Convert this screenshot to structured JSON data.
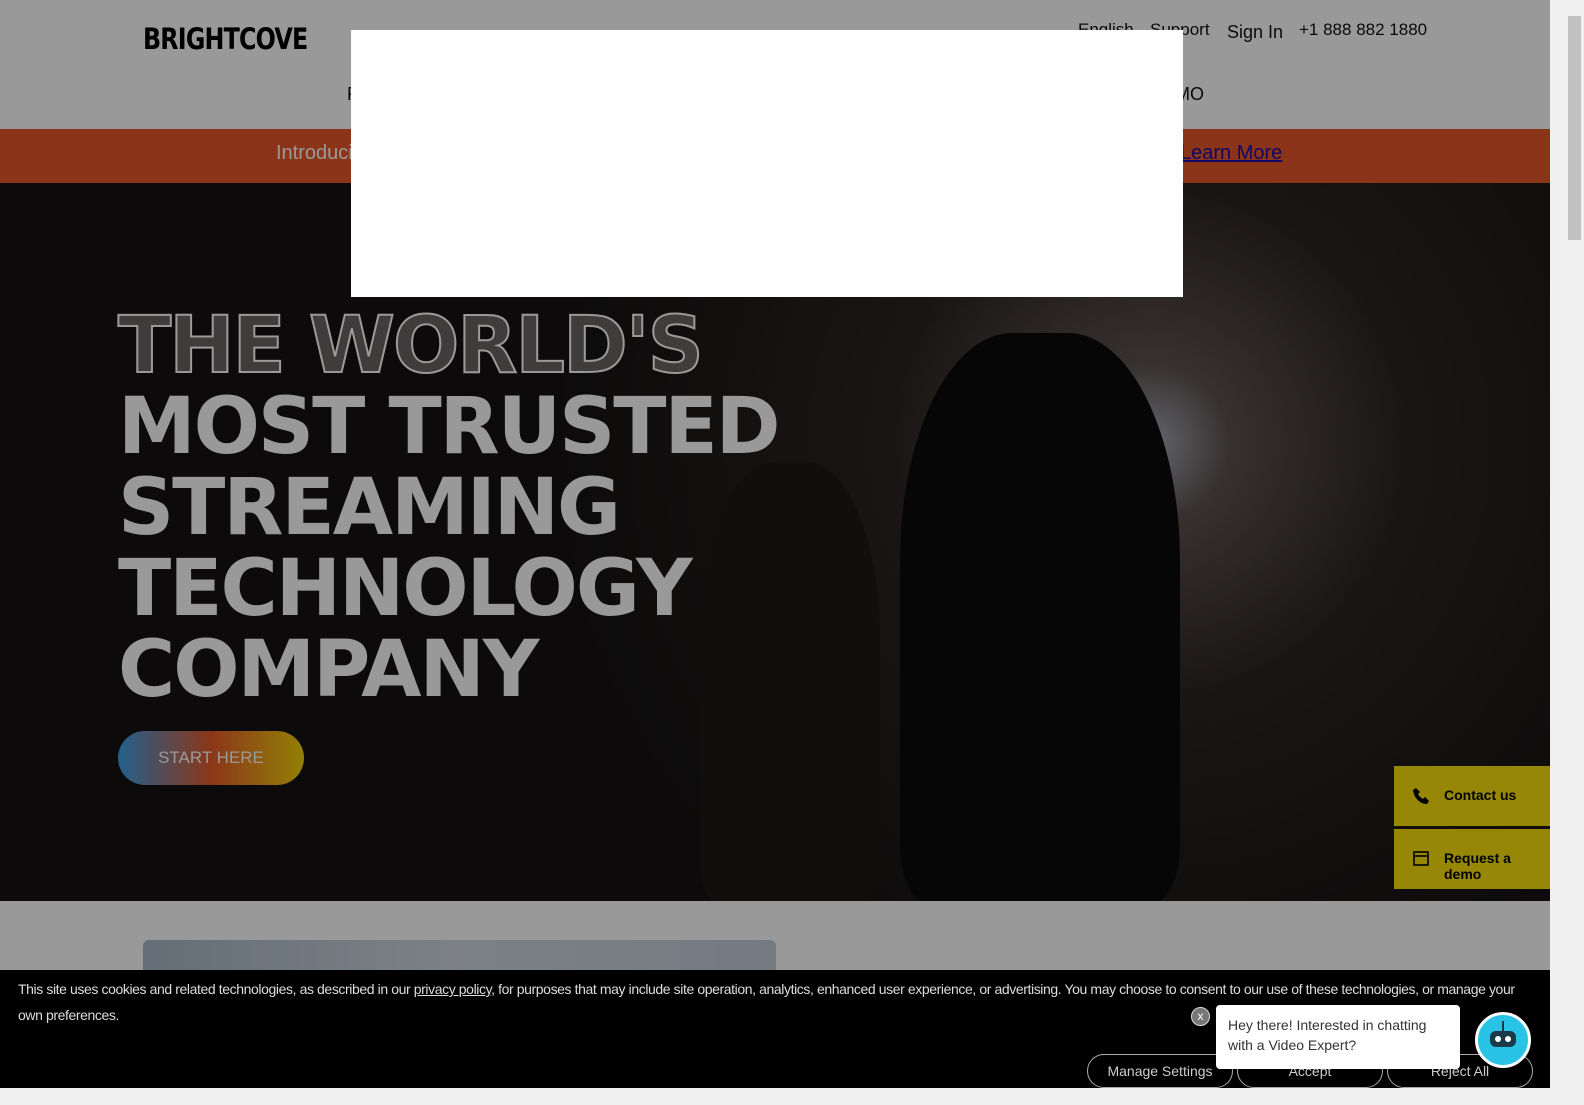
{
  "header": {
    "logo": "BRIGHTCOVE",
    "utility": [
      "English",
      "Support",
      "Sign In",
      "+1 888 882 1880"
    ],
    "nav_left_fragment": "P",
    "nav_right_fragment": "MO"
  },
  "banner": {
    "text_fragment": "Introduci",
    "link": "Learn More"
  },
  "hero": {
    "line1": "THE WORLD'S",
    "line2": "MOST TRUSTED",
    "line3": "STREAMING",
    "line4": "TECHNOLOGY",
    "line5": "COMPANY",
    "cta": "START HERE"
  },
  "side": {
    "contact": "Contact us",
    "demo": "Request a demo"
  },
  "cookie": {
    "text_before": "This site uses cookies and related technologies, as described in our ",
    "link": "privacy policy",
    "text_after": ", for purposes that may include site operation, analytics, enhanced user experience, or advertising. You may choose to consent to our use of these technologies, or manage your own preferences.",
    "manage": "Manage Settings",
    "accept": "Accept",
    "reject": "Reject All"
  },
  "chat": {
    "close": "x",
    "message": "Hey there! Interested in chatting with a Video Expert?"
  },
  "colors": {
    "banner": "#e8572a",
    "side_buttons": "#fbe30a",
    "chat_bot": "#29c3e6"
  }
}
